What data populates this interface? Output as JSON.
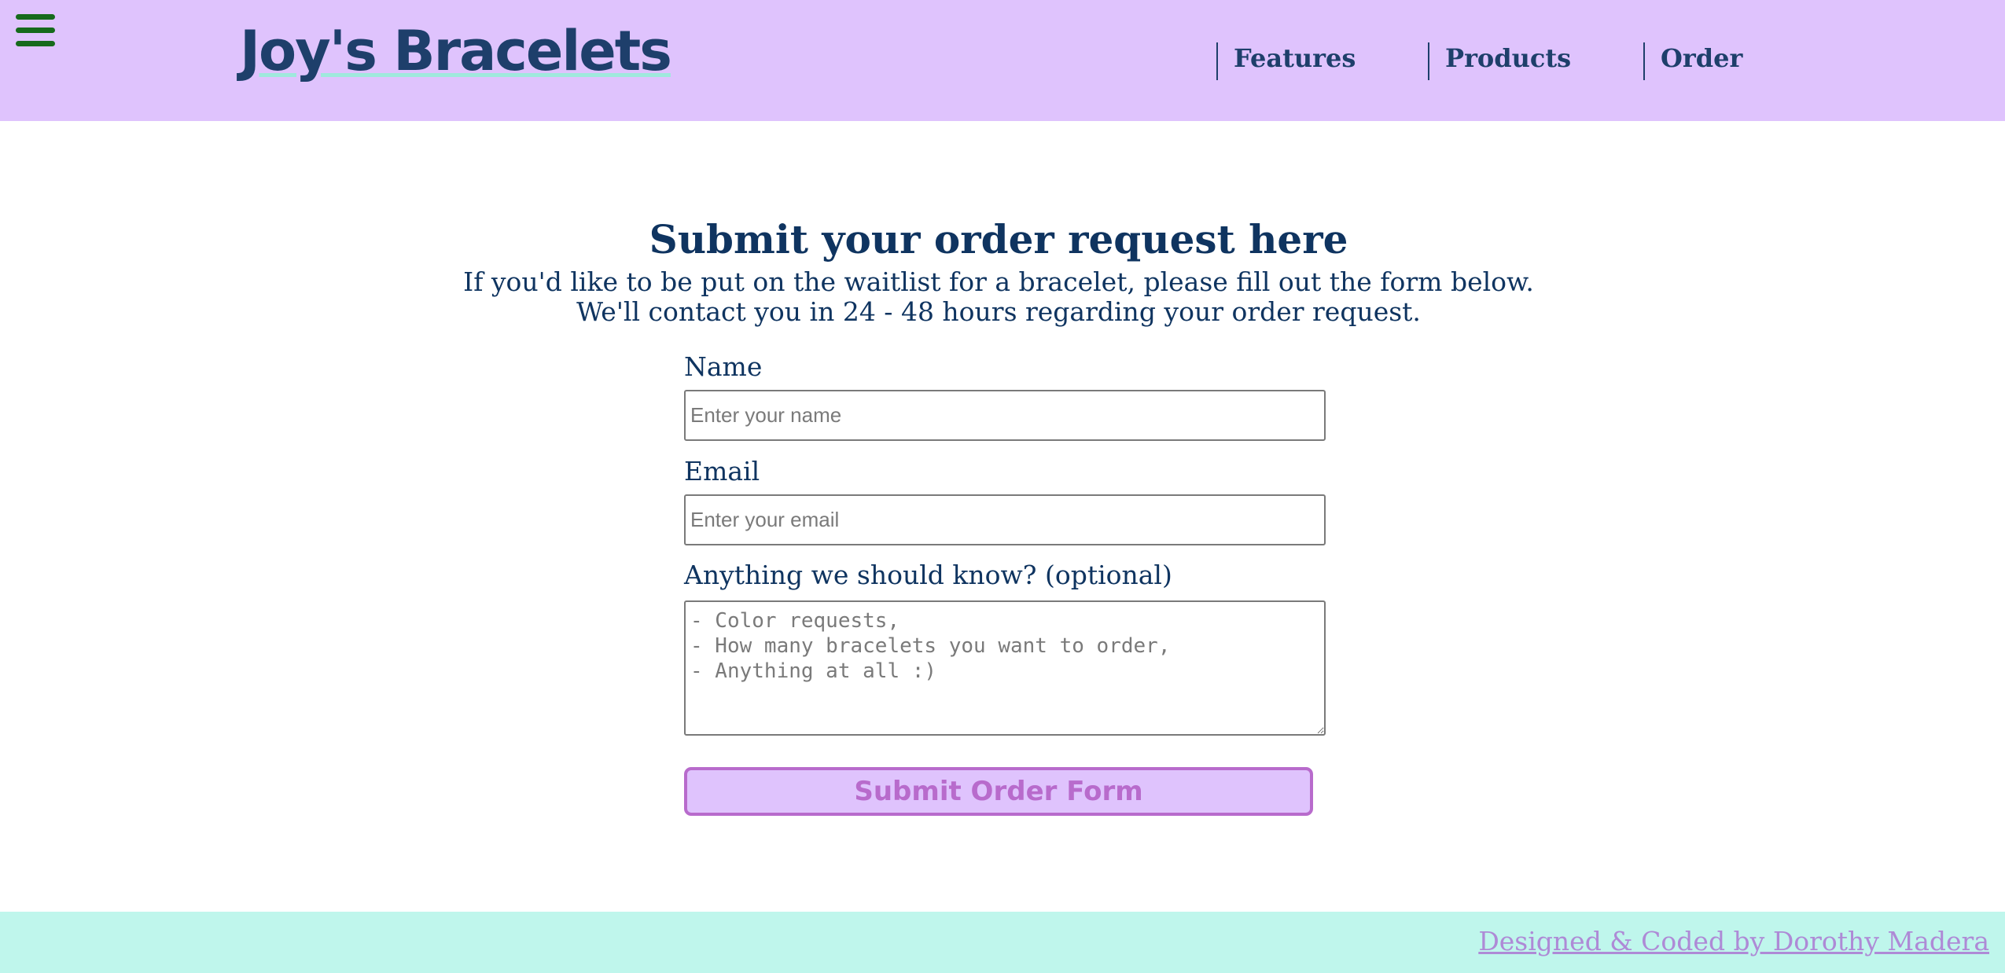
{
  "header": {
    "menu_icon": "hamburger-menu-icon",
    "logo": "Joy's Bracelets",
    "nav": [
      "Features",
      "Products",
      "Order"
    ]
  },
  "main": {
    "title": "Submit your order request here",
    "intro_line1": "If you'd like to be put on the waitlist for a bracelet, please fill out the form below.",
    "intro_line2": "We'll contact you in 24 - 48 hours regarding your order request.",
    "form": {
      "name_label": "Name",
      "name_placeholder": "Enter your name",
      "email_label": "Email",
      "email_placeholder": "Enter your email",
      "notes_label": "Anything we should know? (optional)",
      "notes_placeholder": "- Color requests,\n- How many bracelets you want to order,\n- Anything at all :)",
      "submit_label": "Submit Order Form"
    }
  },
  "footer": {
    "credit": "Designed & Coded by Dorothy Madera"
  },
  "colors": {
    "header_bg": "#dfc3fd",
    "footer_bg": "#bff6ec",
    "text": "#0f3460",
    "button_accent": "#b86bcc",
    "menu_icon": "#166a1c"
  }
}
